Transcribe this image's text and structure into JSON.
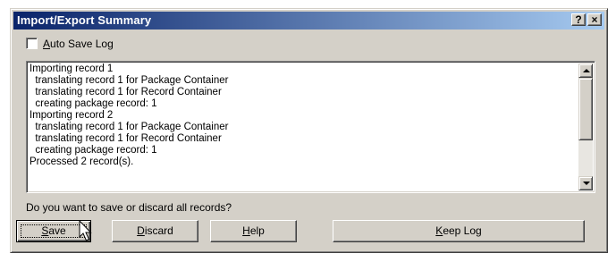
{
  "window": {
    "title": "Import/Export Summary",
    "help_button": "?",
    "close_button": "×"
  },
  "auto_save": {
    "label": "Auto Save Log",
    "checked": false
  },
  "log": {
    "lines": [
      "Importing record 1",
      "  translating record 1 for Package Container",
      "  translating record 1 for Record Container",
      "  creating package record: 1",
      "Importing record 2",
      "  translating record 1 for Package Container",
      "  translating record 1 for Record Container",
      "  creating package record: 1",
      "Processed 2 record(s)."
    ]
  },
  "prompt": "Do you want to save or discard all records?",
  "buttons": {
    "save": "Save",
    "discard": "Discard",
    "help": "Help",
    "keep_log": "Keep Log"
  },
  "colors": {
    "titlebar_start": "#0a246a",
    "titlebar_end": "#a6caf0",
    "face": "#d4d0c8"
  }
}
